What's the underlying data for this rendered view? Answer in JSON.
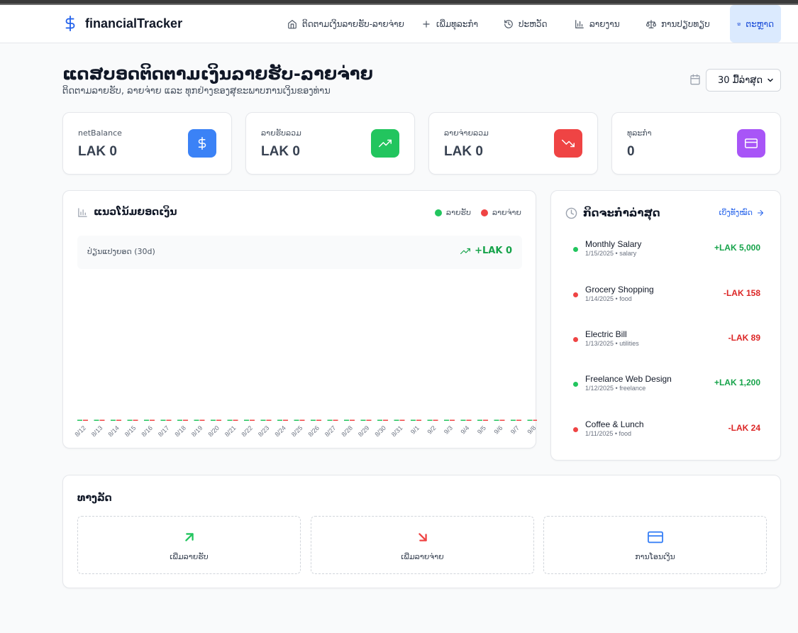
{
  "nav": {
    "brand": "financialTracker",
    "items": [
      {
        "label": "ຕິດຕາມເງິນລາຍຮັບ-ລາຍຈ່າຍ",
        "icon": "home-icon"
      },
      {
        "label": "ເພີ່ມທຸລະກຳ",
        "icon": "plus-icon"
      },
      {
        "label": "ປະຫວັດ",
        "icon": "history-icon"
      },
      {
        "label": "ລາຍງານ",
        "icon": "bar-chart-icon"
      },
      {
        "label": "ການປຽບທຽບ",
        "icon": "scale-icon"
      },
      {
        "label": "ຕະຫຼາດ",
        "icon": "store-icon",
        "active": true
      }
    ]
  },
  "header": {
    "title": "ແດສບອດຕິດຕາມເງິນລາຍຮັບ-ລາຍຈ່າຍ",
    "subtitle": "ຕິດຕາມລາຍຮັບ, ລາຍຈ່າຍ ແລະ ທຸກຢ່າງຂອງສຸຂະພາບການເງິນຂອງທ່ານ",
    "range_selected": "30 ມື້ລ່າສຸດ"
  },
  "stats": [
    {
      "label": "netBalance",
      "value": "LAK 0",
      "icon": "dollar-icon",
      "color": "#3b82f6"
    },
    {
      "label": "ລາຍຮັບລວມ",
      "value": "LAK 0",
      "icon": "trending-up-icon",
      "color": "#22c55e"
    },
    {
      "label": "ລາຍຈ່າຍລວມ",
      "value": "LAK 0",
      "icon": "trending-down-icon",
      "color": "#ef4444"
    },
    {
      "label": "ທຸລະກຳ",
      "value": "0",
      "icon": "credit-card-icon",
      "color": "#a855f7"
    }
  ],
  "chart_section": {
    "title": "ແນວໂນ້ມຍອດເງິນ",
    "legend_income": "ລາຍຮັບ",
    "legend_expense": "ລາຍຈ່າຍ",
    "net_label": "ປ່ຽນແປງຍອດ (30d)",
    "net_value": "+LAK 0"
  },
  "chart_data": {
    "type": "bar",
    "categories": [
      "8/12",
      "8/13",
      "8/14",
      "8/15",
      "8/16",
      "8/17",
      "8/18",
      "8/19",
      "8/20",
      "8/21",
      "8/22",
      "8/23",
      "8/24",
      "8/25",
      "8/26",
      "8/27",
      "8/28",
      "8/29",
      "8/30",
      "8/31",
      "9/1",
      "9/2",
      "9/3",
      "9/4",
      "9/5",
      "9/6",
      "9/7",
      "9/8",
      "9/9",
      "9/10"
    ],
    "series": [
      {
        "name": "ລາຍຮັບ",
        "color": "#22c55e",
        "values": [
          0,
          0,
          0,
          0,
          0,
          0,
          0,
          0,
          0,
          0,
          0,
          0,
          0,
          0,
          0,
          0,
          0,
          0,
          0,
          0,
          0,
          0,
          0,
          0,
          0,
          0,
          0,
          0,
          0,
          0
        ]
      },
      {
        "name": "ລາຍຈ່າຍ",
        "color": "#ef4444",
        "values": [
          0,
          0,
          0,
          0,
          0,
          0,
          0,
          0,
          0,
          0,
          0,
          0,
          0,
          0,
          0,
          0,
          0,
          0,
          0,
          0,
          0,
          0,
          0,
          0,
          0,
          0,
          0,
          0,
          0,
          0
        ]
      }
    ],
    "title": "ແນວໂນ້ມຍອດເງິນ",
    "grid": false,
    "legend": "top-right"
  },
  "activity": {
    "title": "ກິດຈະກຳລ່າສຸດ",
    "view_all": "ເບິ່ງທັງໝົດ",
    "items": [
      {
        "name": "Monthly Salary",
        "meta": "1/15/2025 • salary",
        "amount": "+LAK 5,000",
        "type": "income"
      },
      {
        "name": "Grocery Shopping",
        "meta": "1/14/2025 • food",
        "amount": "-LAK 158",
        "type": "expense"
      },
      {
        "name": "Electric Bill",
        "meta": "1/13/2025 • utilities",
        "amount": "-LAK 89",
        "type": "expense"
      },
      {
        "name": "Freelance Web Design",
        "meta": "1/12/2025 • freelance",
        "amount": "+LAK 1,200",
        "type": "income"
      },
      {
        "name": "Coffee & Lunch",
        "meta": "1/11/2025 • food",
        "amount": "-LAK 24",
        "type": "expense"
      }
    ]
  },
  "shortcuts": {
    "title": "ທາງລັດ",
    "items": [
      {
        "label": "ເພີ່ມລາຍຮັບ",
        "icon": "arrow-up-right-icon",
        "color": "#22c55e"
      },
      {
        "label": "ເພີ່ມລາຍຈ່າຍ",
        "icon": "arrow-down-right-icon",
        "color": "#ef4444"
      },
      {
        "label": "ການໂອນເງິນ",
        "icon": "credit-card-icon",
        "color": "#3b82f6"
      }
    ]
  },
  "colors": {
    "income": "#16a34a",
    "expense": "#dc2626",
    "accent": "#2563eb"
  }
}
